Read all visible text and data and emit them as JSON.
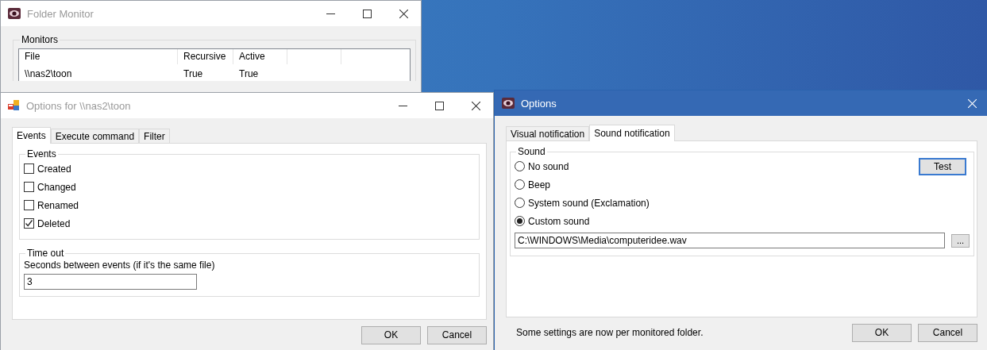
{
  "folder_monitor": {
    "title": "Folder Monitor",
    "active": false,
    "group": "Monitors",
    "columns": [
      "File",
      "Recursive",
      "Active"
    ],
    "rows": [
      {
        "cells": [
          "\\\\nas2\\toon",
          "True",
          "True"
        ]
      }
    ]
  },
  "event_options": {
    "title": "Options for \\\\nas2\\toon",
    "active": false,
    "tabs": [
      {
        "label": "Events",
        "selected": true
      },
      {
        "label": "Execute command",
        "selected": false
      },
      {
        "label": "Filter",
        "selected": false
      }
    ],
    "events_group": "Events",
    "events": [
      {
        "label": "Created",
        "checked": false
      },
      {
        "label": "Changed",
        "checked": false
      },
      {
        "label": "Renamed",
        "checked": false
      },
      {
        "label": "Deleted",
        "checked": true
      }
    ],
    "timeout_group": "Time out",
    "timeout_label": "Seconds between events (if it's the same file)",
    "timeout_value": "3",
    "buttons": [
      "OK",
      "Cancel"
    ]
  },
  "sound_options": {
    "title": "Options",
    "active": true,
    "tabs": [
      {
        "label": "Visual notification",
        "selected": false
      },
      {
        "label": "Sound notification",
        "selected": true
      }
    ],
    "group": "Sound",
    "options": [
      {
        "label": "No sound",
        "selected": false
      },
      {
        "label": "Beep",
        "selected": false
      },
      {
        "label": "System sound (Exclamation)",
        "selected": false
      },
      {
        "label": "Custom sound",
        "selected": true
      }
    ],
    "test_button": "Test",
    "path": "C:\\WINDOWS\\Media\\computeridee.wav",
    "browse_button": "...",
    "note": "Some settings are now per monitored folder.",
    "buttons": [
      "OK",
      "Cancel"
    ]
  }
}
